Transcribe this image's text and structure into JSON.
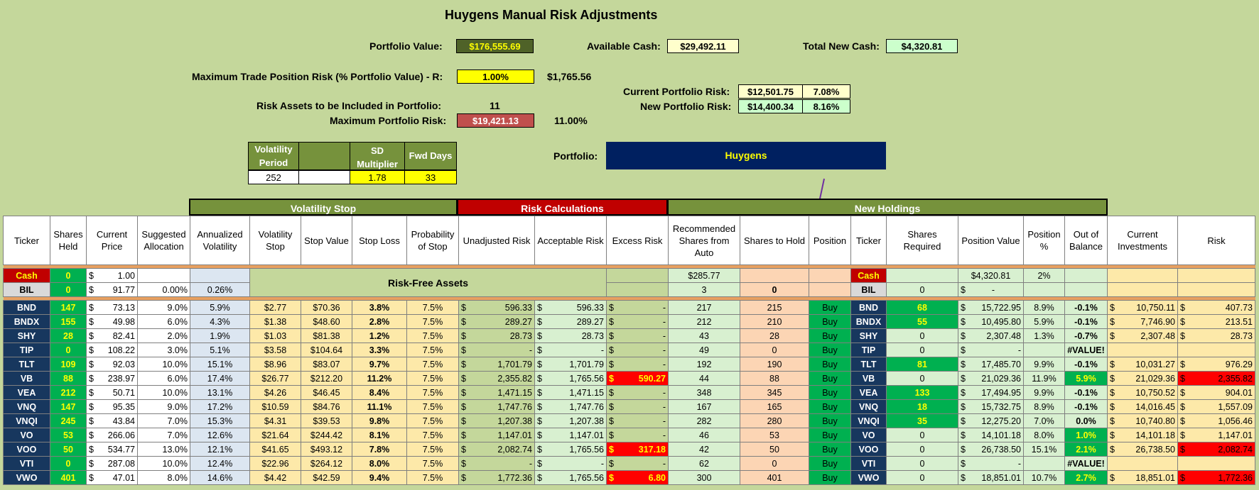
{
  "title": "Huygens Manual Risk Adjustments",
  "summary": {
    "portfolio_value_label": "Portfolio Value:",
    "portfolio_value": "$176,555.69",
    "available_cash_label": "Available Cash:",
    "available_cash": "$29,492.11",
    "total_new_cash_label": "Total New Cash:",
    "total_new_cash": "$4,320.81",
    "max_trade_risk_label": "Maximum Trade Position Risk (% Portfolio Value) - R:",
    "max_trade_risk_pct": "1.00%",
    "max_trade_risk_value": "$1,765.56",
    "current_risk_label": "Current Portfolio Risk:",
    "current_risk": "$12,501.75",
    "current_risk_pct": "7.08%",
    "new_risk_label": "New Portfolio Risk:",
    "new_risk": "$14,400.34",
    "new_risk_pct": "8.16%",
    "risk_assets_label": "Risk Assets to be Included in Portfolio:",
    "risk_assets": "11",
    "max_portfolio_risk_label": "Maximum Portfolio Risk:",
    "max_portfolio_risk": "$19,421.13",
    "max_portfolio_risk_pct": "11.00%",
    "vol_period_label": "Volatility Period",
    "vol_period": "252",
    "sd_mult_label": "SD Multiplier",
    "sd_mult": "1.78",
    "fwd_days_label": "Fwd Days",
    "fwd_days": "33",
    "portfolio_label": "Portfolio:",
    "portfolio_name": "Huygens"
  },
  "sections": {
    "vol_stop": "Volatility Stop",
    "risk_calc": "Risk Calculations",
    "new_holdings": "New Holdings"
  },
  "headers": [
    "Ticker",
    "Shares Held",
    "Current Price",
    "Suggested Allocation",
    "Annualized Volatility",
    "Volatility Stop",
    "Stop Value",
    "Stop Loss",
    "Probability of Stop",
    "Unadjusted Risk",
    "Acceptable Risk",
    "Excess Risk",
    "Recommended Shares from Auto",
    "Shares to Hold",
    "Position",
    "Ticker",
    "Shares Required",
    "Position Value",
    "Position %",
    "Out of Balance",
    "Current Investments",
    "Risk"
  ],
  "cash_row": {
    "ticker": "Cash",
    "held": "0",
    "price": "1.00",
    "rec": "$285.77",
    "ticker2": "Cash",
    "pv": "$4,320.81",
    "pct": "2%"
  },
  "bil_row": {
    "ticker": "BIL",
    "held": "0",
    "price": "91.77",
    "alloc": "0.00%",
    "vol": "0.26%",
    "riskfree": "Risk-Free Assets",
    "rec": "3",
    "hold": "0",
    "ticker2": "BIL",
    "req": "0",
    "pv": "-"
  },
  "rows": [
    {
      "t": "BND",
      "held": "147",
      "price": "73.13",
      "alloc": "9.0%",
      "vol": "5.9%",
      "vs": "$2.77",
      "sv": "$70.36",
      "sl": "3.8%",
      "ps": "7.5%",
      "ur": "596.33",
      "ar": "596.33",
      "er": "-",
      "rec": "217",
      "hold": "215",
      "pos": "Buy",
      "req": "68",
      "pv": "15,722.95",
      "pp": "8.9%",
      "ob": "-0.1%",
      "ci": "10,750.11",
      "risk": "407.73"
    },
    {
      "t": "BNDX",
      "held": "155",
      "price": "49.98",
      "alloc": "6.0%",
      "vol": "4.3%",
      "vs": "$1.38",
      "sv": "$48.60",
      "sl": "2.8%",
      "ps": "7.5%",
      "ur": "289.27",
      "ar": "289.27",
      "er": "-",
      "rec": "212",
      "hold": "210",
      "pos": "Buy",
      "req": "55",
      "pv": "10,495.80",
      "pp": "5.9%",
      "ob": "-0.1%",
      "ci": "7,746.90",
      "risk": "213.51"
    },
    {
      "t": "SHY",
      "held": "28",
      "price": "82.41",
      "alloc": "2.0%",
      "vol": "1.9%",
      "vs": "$1.03",
      "sv": "$81.38",
      "sl": "1.2%",
      "ps": "7.5%",
      "ur": "28.73",
      "ar": "28.73",
      "er": "-",
      "rec": "43",
      "hold": "28",
      "pos": "Buy",
      "req": "0",
      "pv": "2,307.48",
      "pp": "1.3%",
      "ob": "-0.7%",
      "ci": "2,307.48",
      "risk": "28.73"
    },
    {
      "t": "TIP",
      "held": "0",
      "price": "108.22",
      "alloc": "3.0%",
      "vol": "5.1%",
      "vs": "$3.58",
      "sv": "$104.64",
      "sl": "3.3%",
      "ps": "7.5%",
      "ur": "-",
      "ar": "-",
      "er": "-",
      "rec": "49",
      "hold": "0",
      "pos": "Buy",
      "req": "0",
      "pv": "-",
      "pp": "",
      "ob": "#VALUE!",
      "ci": "",
      "risk": ""
    },
    {
      "t": "TLT",
      "held": "109",
      "price": "92.03",
      "alloc": "10.0%",
      "vol": "15.1%",
      "vs": "$8.96",
      "sv": "$83.07",
      "sl": "9.7%",
      "ps": "7.5%",
      "ur": "1,701.79",
      "ar": "1,701.79",
      "er": "-",
      "rec": "192",
      "hold": "190",
      "pos": "Buy",
      "req": "81",
      "pv": "17,485.70",
      "pp": "9.9%",
      "ob": "-0.1%",
      "ci": "10,031.27",
      "risk": "976.29"
    },
    {
      "t": "VB",
      "held": "88",
      "price": "238.97",
      "alloc": "6.0%",
      "vol": "17.4%",
      "vs": "$26.77",
      "sv": "$212.20",
      "sl": "11.2%",
      "ps": "7.5%",
      "ur": "2,355.82",
      "ar": "1,765.56",
      "er": "590.27",
      "rec": "44",
      "hold": "88",
      "pos": "Buy",
      "req": "0",
      "pv": "21,029.36",
      "pp": "11.9%",
      "ob": "5.9%",
      "ci": "21,029.36",
      "risk": "2,355.82"
    },
    {
      "t": "VEA",
      "held": "212",
      "price": "50.71",
      "alloc": "10.0%",
      "vol": "13.1%",
      "vs": "$4.26",
      "sv": "$46.45",
      "sl": "8.4%",
      "ps": "7.5%",
      "ur": "1,471.15",
      "ar": "1,471.15",
      "er": "-",
      "rec": "348",
      "hold": "345",
      "pos": "Buy",
      "req": "133",
      "pv": "17,494.95",
      "pp": "9.9%",
      "ob": "-0.1%",
      "ci": "10,750.52",
      "risk": "904.01"
    },
    {
      "t": "VNQ",
      "held": "147",
      "price": "95.35",
      "alloc": "9.0%",
      "vol": "17.2%",
      "vs": "$10.59",
      "sv": "$84.76",
      "sl": "11.1%",
      "ps": "7.5%",
      "ur": "1,747.76",
      "ar": "1,747.76",
      "er": "-",
      "rec": "167",
      "hold": "165",
      "pos": "Buy",
      "req": "18",
      "pv": "15,732.75",
      "pp": "8.9%",
      "ob": "-0.1%",
      "ci": "14,016.45",
      "risk": "1,557.09"
    },
    {
      "t": "VNQI",
      "held": "245",
      "price": "43.84",
      "alloc": "7.0%",
      "vol": "15.3%",
      "vs": "$4.31",
      "sv": "$39.53",
      "sl": "9.8%",
      "ps": "7.5%",
      "ur": "1,207.38",
      "ar": "1,207.38",
      "er": "-",
      "rec": "282",
      "hold": "280",
      "pos": "Buy",
      "req": "35",
      "pv": "12,275.20",
      "pp": "7.0%",
      "ob": "0.0%",
      "ci": "10,740.80",
      "risk": "1,056.46"
    },
    {
      "t": "VO",
      "held": "53",
      "price": "266.06",
      "alloc": "7.0%",
      "vol": "12.6%",
      "vs": "$21.64",
      "sv": "$244.42",
      "sl": "8.1%",
      "ps": "7.5%",
      "ur": "1,147.01",
      "ar": "1,147.01",
      "er": "-",
      "rec": "46",
      "hold": "53",
      "pos": "Buy",
      "req": "0",
      "pv": "14,101.18",
      "pp": "8.0%",
      "ob": "1.0%",
      "ci": "14,101.18",
      "risk": "1,147.01"
    },
    {
      "t": "VOO",
      "held": "50",
      "price": "534.77",
      "alloc": "13.0%",
      "vol": "12.1%",
      "vs": "$41.65",
      "sv": "$493.12",
      "sl": "7.8%",
      "ps": "7.5%",
      "ur": "2,082.74",
      "ar": "1,765.56",
      "er": "317.18",
      "rec": "42",
      "hold": "50",
      "pos": "Buy",
      "req": "0",
      "pv": "26,738.50",
      "pp": "15.1%",
      "ob": "2.1%",
      "ci": "26,738.50",
      "risk": "2,082.74"
    },
    {
      "t": "VTI",
      "held": "0",
      "price": "287.08",
      "alloc": "10.0%",
      "vol": "12.4%",
      "vs": "$22.96",
      "sv": "$264.12",
      "sl": "8.0%",
      "ps": "7.5%",
      "ur": "-",
      "ar": "-",
      "er": "-",
      "rec": "62",
      "hold": "0",
      "pos": "Buy",
      "req": "0",
      "pv": "-",
      "pp": "",
      "ob": "#VALUE!",
      "ci": "",
      "risk": ""
    },
    {
      "t": "VWO",
      "held": "401",
      "price": "47.01",
      "alloc": "8.0%",
      "vol": "14.6%",
      "vs": "$4.42",
      "sv": "$42.59",
      "sl": "9.4%",
      "ps": "7.5%",
      "ur": "1,772.36",
      "ar": "1,765.56",
      "er": "6.80",
      "rec": "300",
      "hold": "401",
      "pos": "Buy",
      "req": "0",
      "pv": "18,851.01",
      "pp": "10.7%",
      "ob": "2.7%",
      "ci": "18,851.01",
      "risk": "1,772.36"
    }
  ],
  "colors": {
    "navy": "#17375e",
    "green": "#00b050",
    "red": "#ff0000",
    "olive": "#76923c",
    "background": "#c4d79b"
  }
}
